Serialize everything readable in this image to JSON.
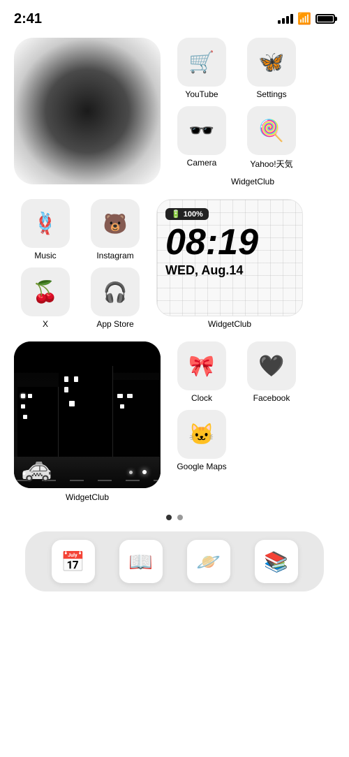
{
  "status": {
    "time": "2:41",
    "battery": "100%"
  },
  "row1": {
    "widget_label": "WidgetClub",
    "apps": [
      {
        "id": "youtube",
        "label": "YouTube",
        "icon": "🛒",
        "emoji": "🛒"
      },
      {
        "id": "settings",
        "label": "Settings",
        "icon": "🦋",
        "emoji": "🦋"
      }
    ]
  },
  "row2": {
    "apps": [
      {
        "id": "camera",
        "label": "Camera",
        "emoji": "🕶️"
      },
      {
        "id": "yahoo",
        "label": "Yahoo!天気",
        "emoji": "🍭"
      }
    ]
  },
  "row3": {
    "apps": [
      {
        "id": "music",
        "label": "Music",
        "emoji": "🪢"
      },
      {
        "id": "instagram",
        "label": "Instagram",
        "emoji": "🐻"
      },
      {
        "id": "x",
        "label": "X",
        "emoji": "🍒"
      },
      {
        "id": "appstore",
        "label": "App Store",
        "emoji": "🎧"
      }
    ],
    "clock": {
      "battery_label": "100%",
      "time": "08:19",
      "date": "WED, Aug.14",
      "label": "WidgetClub"
    }
  },
  "row4": {
    "widget_label": "WidgetClub",
    "apps": [
      {
        "id": "clock",
        "label": "Clock",
        "emoji": "🎀"
      },
      {
        "id": "facebook",
        "label": "Facebook",
        "emoji": "🖤"
      },
      {
        "id": "googlemaps",
        "label": "Google Maps",
        "emoji": "🐱"
      }
    ]
  },
  "dock": {
    "items": [
      {
        "id": "dock-calendar",
        "emoji": "📅"
      },
      {
        "id": "dock-books",
        "emoji": "📖"
      },
      {
        "id": "dock-flying-saucer",
        "emoji": "🪐"
      },
      {
        "id": "dock-stack",
        "emoji": "📚"
      }
    ]
  },
  "page": {
    "dots": [
      "active",
      "inactive"
    ],
    "dot_labels": [
      "Page 1",
      "Page 2"
    ]
  }
}
